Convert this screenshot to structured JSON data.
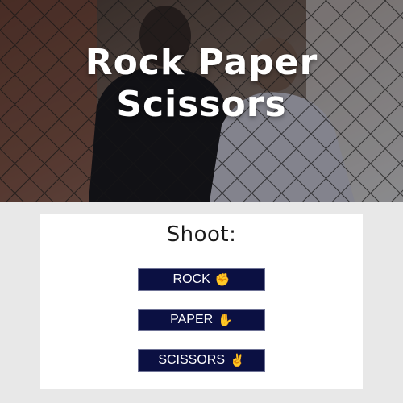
{
  "header": {
    "title_line1": "Rock Paper",
    "title_line2": "Scissors"
  },
  "game": {
    "prompt": "Shoot:",
    "buttons": [
      {
        "label": "ROCK",
        "icon": "✊"
      },
      {
        "label": "PAPER",
        "icon": "✋"
      },
      {
        "label": "SCISSORS",
        "icon": "✌"
      }
    ]
  },
  "colors": {
    "button_bg": "#0b1042",
    "button_text": "#ffffff",
    "page_bg": "#e8e8e8",
    "card_bg": "#ffffff"
  }
}
